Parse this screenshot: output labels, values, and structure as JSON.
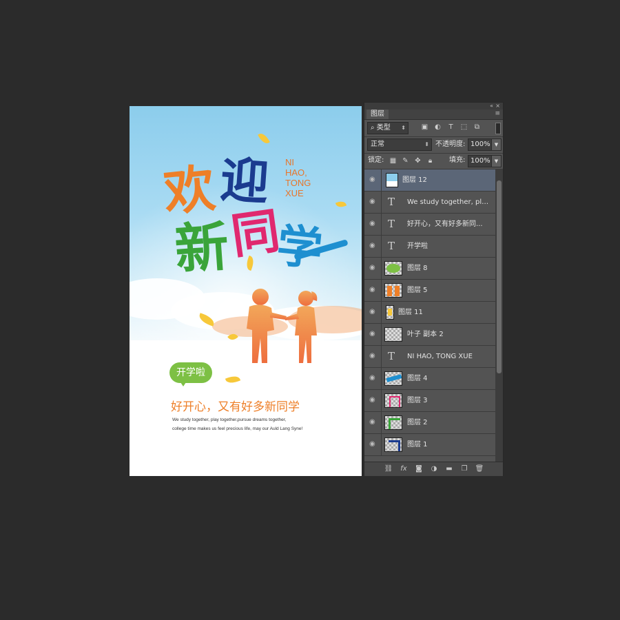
{
  "poster": {
    "title_chars": [
      "欢",
      "迎",
      "新",
      "同",
      "学"
    ],
    "en_title_lines": [
      "NI",
      "HAO,",
      "TONG",
      "XUE"
    ],
    "bubble_text": "开学啦",
    "subtitle": "好开心，又有好多新同学",
    "english_line1": "We study together, play together,pursue dreams together,",
    "english_line2": "college time makes us feel precious life, may our Auld Lang Syne!",
    "colors": {
      "orange": "#ee7f28",
      "green": "#3aa43a",
      "blue": "#1e8fd0",
      "magenta": "#e0286f",
      "navy": "#1b3b8f"
    }
  },
  "panel": {
    "tab_label": "图层",
    "filter": {
      "label": "类型",
      "icons": [
        "image-filter-icon",
        "adjustment-filter-icon",
        "text-filter-icon",
        "shape-filter-icon",
        "smartobject-filter-icon"
      ]
    },
    "blend_mode": "正常",
    "opacity_label": "不透明度:",
    "opacity_value": "100%",
    "lock_label": "锁定:",
    "fill_label": "填充:",
    "fill_value": "100%",
    "layers": [
      {
        "name": "图层 12",
        "type": "image",
        "thumb": "poster",
        "selected": true
      },
      {
        "name": "We study together, play ...",
        "type": "text"
      },
      {
        "name": "好开心，又有好多新同...",
        "type": "text"
      },
      {
        "name": "开学啦",
        "type": "text"
      },
      {
        "name": "图层 8",
        "type": "image",
        "thumb": "green-blob"
      },
      {
        "name": "图层 5",
        "type": "image",
        "thumb": "orange-kids"
      },
      {
        "name": "图层 11",
        "type": "image",
        "thumb": "yellow-leaf"
      },
      {
        "name": "叶子 副本 2",
        "type": "image",
        "thumb": "empty"
      },
      {
        "name": "NI HAO, TONG XUE",
        "type": "text"
      },
      {
        "name": "图层 4",
        "type": "image",
        "thumb": "blue-stroke"
      },
      {
        "name": "图层 3",
        "type": "image",
        "thumb": "pink-stroke"
      },
      {
        "name": "图层 2",
        "type": "image",
        "thumb": "green-stroke"
      },
      {
        "name": "图层 1",
        "type": "image",
        "thumb": "navy-stroke"
      }
    ]
  }
}
